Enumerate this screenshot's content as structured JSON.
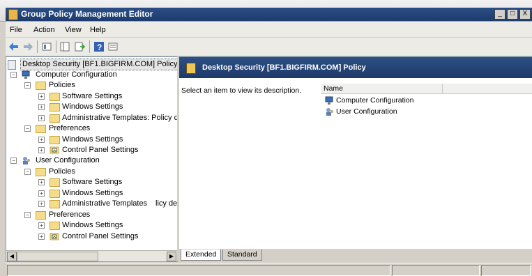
{
  "window": {
    "title": "Group Policy Management Editor",
    "min": "_",
    "max": "□",
    "close": "X"
  },
  "menu": {
    "file": "File",
    "action": "Action",
    "view": "View",
    "help": "Help"
  },
  "tree": {
    "root": "Desktop Security [BF1.BIGFIRM.COM] Policy",
    "computer_configuration": "Computer Configuration",
    "cc_policies": "Policies",
    "cc_software_settings": "Software Settings",
    "cc_windows_settings": "Windows Settings",
    "cc_admin_templates": "Administrative Templates: Policy de",
    "cc_preferences": "Preferences",
    "cc_pref_windows_settings": "Windows Settings",
    "cc_pref_control_panel": "Control Panel Settings",
    "user_configuration": "User Configuration",
    "uc_policies": "Policies",
    "uc_software_settings": "Software Settings",
    "uc_windows_settings": "Windows Settings",
    "uc_admin_templates": "Administrative Templates",
    "uc_admin_templates_suffix": "licy de",
    "uc_preferences": "Preferences",
    "uc_pref_windows_settings": "Windows Settings",
    "uc_pref_control_panel": "Control Panel Settings"
  },
  "right": {
    "header": "Desktop Security [BF1.BIGFIRM.COM] Policy",
    "description": "Select an item to view its description.",
    "column_name": "Name",
    "items": [
      "Computer Configuration",
      "User Configuration"
    ]
  },
  "tabs": {
    "extended": "Extended",
    "standard": "Standard"
  },
  "icons": {
    "back": "arrow-left-icon",
    "forward": "arrow-right-icon",
    "help": "help-icon"
  }
}
